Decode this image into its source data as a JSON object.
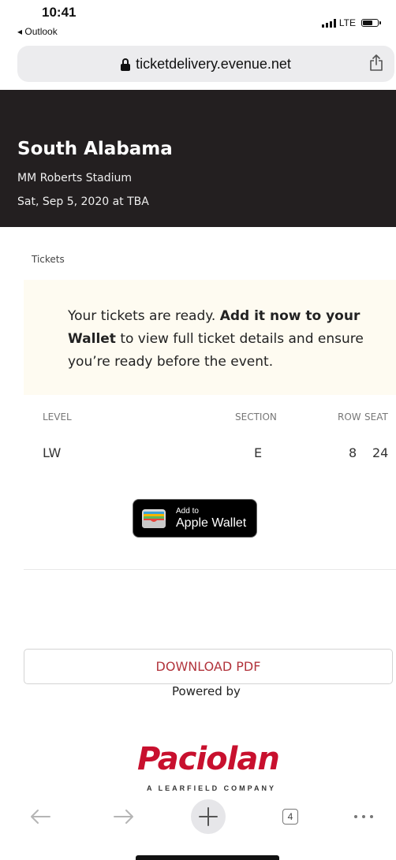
{
  "status_bar": {
    "time": "10:41",
    "back_app": "◂ Outlook",
    "network": "LTE"
  },
  "browser": {
    "url": "ticketdelivery.evenue.net",
    "tab_count": "4"
  },
  "event": {
    "title": "South Alabama",
    "venue": "MM Roberts Stadium",
    "date": "Sat, Sep 5, 2020 at TBA"
  },
  "tickets": {
    "label": "Tickets",
    "notice_pre": "Your tickets are ready. ",
    "notice_bold": "Add it now to your Wallet",
    "notice_post": " to view full ticket details and ensure you’re ready before the event.",
    "columns": [
      "LEVEL",
      "SECTION",
      "ROW",
      "SEAT"
    ],
    "row": {
      "level": "LW",
      "section": "E",
      "row": "8",
      "seat": "24"
    }
  },
  "wallet_button": {
    "line1": "Add to",
    "line2": "Apple Wallet"
  },
  "download_button": "DOWNLOAD PDF",
  "footer": {
    "powered_by": "Powered by",
    "brand": "Paciolan",
    "brand_sub": "A LEARFIELD COMPANY"
  },
  "colors": {
    "header_bg": "#231f20",
    "notice_bg": "#fefbf1",
    "download_text": "#b2343c",
    "brand": "#c8102e"
  }
}
